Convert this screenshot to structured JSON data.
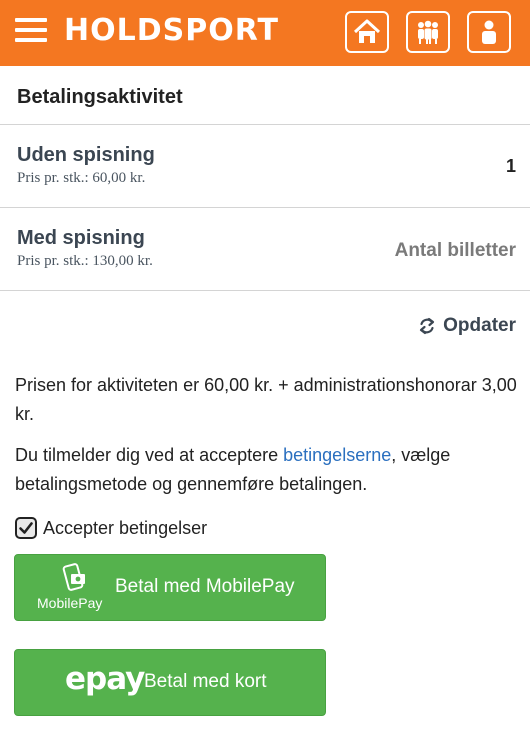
{
  "header": {
    "brand": "HOLDSPORT",
    "icons": [
      "menu-icon",
      "home-icon",
      "team-icon",
      "profile-icon"
    ],
    "color": "#f47721"
  },
  "section_title": "Betalingsaktivitet",
  "items": [
    {
      "name": "Uden spisning",
      "price": "Pris pr. stk.: 60,00 kr.",
      "quantity": "1"
    },
    {
      "name": "Med spisning",
      "price": "Pris pr. stk.: 130,00 kr.",
      "quantity_placeholder": "Antal billetter"
    }
  ],
  "update_label": "Opdater",
  "price_info": "Prisen for aktiviteten er 60,00 kr. + administrationshonorar 3,00 kr.",
  "terms": {
    "before": "Du tilmelder dig ved at acceptere ",
    "link": "betingelserne",
    "after": ", vælge betalingsmetode og gennemføre betalingen."
  },
  "accept_label": "Accepter betingelser",
  "accept_checked": true,
  "payment": {
    "mobilepay_brand": "MobilePay",
    "mobilepay_label": "Betal med MobilePay",
    "epay_brand": "epay",
    "card_label": "Betal med kort",
    "button_color": "#55b24d"
  }
}
